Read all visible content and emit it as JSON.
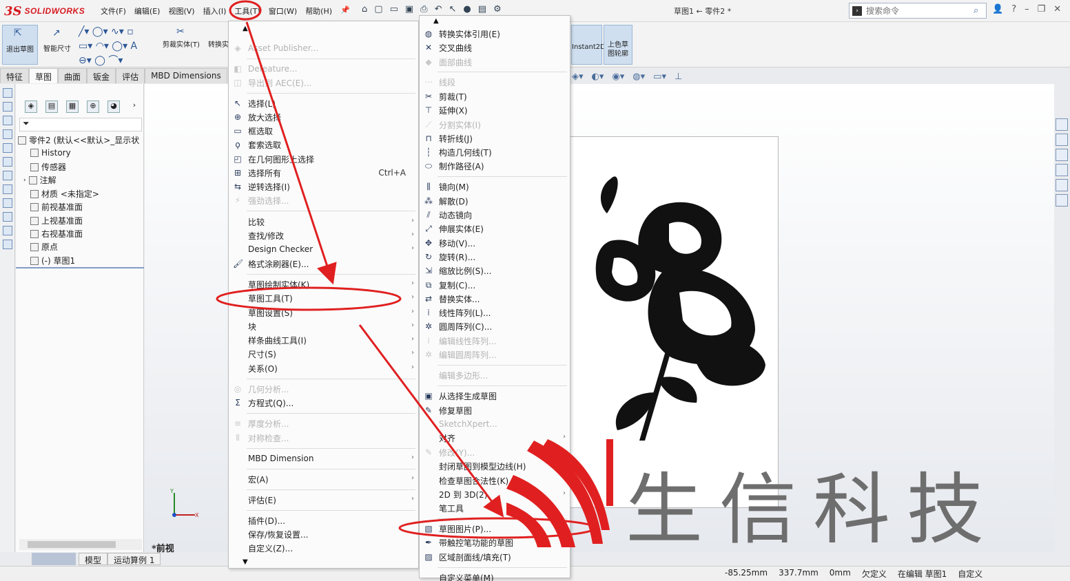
{
  "app": {
    "logo_ds": "3S",
    "logo_name": "SOLIDWORKS",
    "doc_title": "草图1 ← 零件2 *",
    "search_placeholder": "搜索命令"
  },
  "menubar": [
    "文件(F)",
    "编辑(E)",
    "视图(V)",
    "插入(I)",
    "工具(T)",
    "窗口(W)",
    "帮助(H)"
  ],
  "commands": {
    "exit_sketch": "退出草图",
    "smart_dim": "智能尺寸",
    "trim": "剪裁实体(T)",
    "convert": "转换实",
    "instant2d": "Instant2D",
    "shaded_line1": "上色草",
    "shaded_line2": "图轮廓"
  },
  "tabs": [
    "特征",
    "草图",
    "曲面",
    "钣金",
    "评估",
    "MBD Dimensions"
  ],
  "tree": {
    "root": "零件2 (默认<<默认>_显示状",
    "items": [
      "History",
      "传感器",
      "注解",
      "材质 <未指定>",
      "前视基准面",
      "上视基准面",
      "右视基准面",
      "原点",
      "(-) 草图1"
    ]
  },
  "bottom_tabs": [
    "模型",
    "运动算例 1"
  ],
  "view_label": "*前视",
  "tools_menu": {
    "items": [
      {
        "label": "Asset Publisher...",
        "disabled": true,
        "icon": "asset-icon"
      },
      {
        "label": "Defeature...",
        "disabled": true,
        "icon": "defeature-icon"
      },
      {
        "label": "导出到 AEC(E)...",
        "disabled": true,
        "icon": "aec-icon"
      },
      {
        "label": "选择(L)",
        "icon": "select-icon"
      },
      {
        "label": "放大选择",
        "icon": "magnify-icon"
      },
      {
        "label": "框选取",
        "icon": "box-select-icon"
      },
      {
        "label": "套索选取",
        "icon": "lasso-icon"
      },
      {
        "label": "在几何图形上选择",
        "icon": "geometry-select-icon"
      },
      {
        "label": "选择所有",
        "shortcut": "Ctrl+A",
        "icon": "select-all-icon"
      },
      {
        "label": "逆转选择(I)",
        "icon": "invert-select-icon"
      },
      {
        "label": "强劲选择...",
        "disabled": true,
        "icon": "power-select-icon"
      },
      {
        "label": "比较",
        "submenu": true
      },
      {
        "label": "查找/修改",
        "submenu": true
      },
      {
        "label": "Design Checker",
        "submenu": true
      },
      {
        "label": "格式涂刷器(E)...",
        "icon": "format-painter-icon"
      },
      {
        "label": "草图绘制实体(K)",
        "submenu": true
      },
      {
        "label": "草图工具(T)",
        "submenu": true
      },
      {
        "label": "草图设置(S)",
        "submenu": true
      },
      {
        "label": "块",
        "submenu": true
      },
      {
        "label": "样条曲线工具(I)",
        "submenu": true
      },
      {
        "label": "尺寸(S)",
        "submenu": true
      },
      {
        "label": "关系(O)",
        "submenu": true
      },
      {
        "label": "几何分析...",
        "disabled": true,
        "icon": "geometry-analysis-icon"
      },
      {
        "label": "方程式(Q)...",
        "icon": "sigma-icon"
      },
      {
        "label": "厚度分析...",
        "disabled": true,
        "icon": "thickness-icon"
      },
      {
        "label": "对称检查...",
        "disabled": true,
        "icon": "symmetry-icon"
      },
      {
        "label": "MBD Dimension",
        "submenu": true
      },
      {
        "label": "宏(A)",
        "submenu": true
      },
      {
        "label": "评估(E)",
        "submenu": true
      },
      {
        "label": "插件(D)..."
      },
      {
        "label": "保存/恢复设置..."
      },
      {
        "label": "自定义(Z)..."
      }
    ]
  },
  "sketch_menu": {
    "items": [
      {
        "label": "转换实体引用(E)",
        "icon": "convert-icon"
      },
      {
        "label": "交叉曲线",
        "icon": "intersect-icon"
      },
      {
        "label": "面部曲线",
        "disabled": true,
        "icon": "face-curve-icon"
      },
      {
        "label": "线段",
        "disabled": true,
        "icon": "segment-icon"
      },
      {
        "label": "剪裁(T)",
        "icon": "trim-icon"
      },
      {
        "label": "延伸(X)",
        "icon": "extend-icon"
      },
      {
        "label": "分割实体(I)",
        "disabled": true,
        "icon": "split-icon"
      },
      {
        "label": "转折线(J)",
        "icon": "jog-icon"
      },
      {
        "label": "构造几何线(T)",
        "icon": "construction-icon"
      },
      {
        "label": "制作路径(A)",
        "icon": "path-icon"
      },
      {
        "label": "镜向(M)",
        "icon": "mirror-icon"
      },
      {
        "label": "解散(D)",
        "icon": "dissolve-icon"
      },
      {
        "label": "动态镜向",
        "icon": "dynamic-mirror-icon"
      },
      {
        "label": "伸展实体(E)",
        "icon": "stretch-icon"
      },
      {
        "label": "移动(V)...",
        "icon": "move-icon"
      },
      {
        "label": "旋转(R)...",
        "icon": "rotate-icon"
      },
      {
        "label": "缩放比例(S)...",
        "icon": "scale-icon"
      },
      {
        "label": "复制(C)...",
        "icon": "copy-icon"
      },
      {
        "label": "替换实体...",
        "icon": "replace-icon"
      },
      {
        "label": "线性阵列(L)...",
        "icon": "linear-pattern-icon"
      },
      {
        "label": "圆周阵列(C)...",
        "icon": "circular-pattern-icon"
      },
      {
        "label": "编辑线性阵列...",
        "disabled": true,
        "icon": "edit-linear-icon"
      },
      {
        "label": "编辑圆周阵列...",
        "disabled": true,
        "icon": "edit-circular-icon"
      },
      {
        "label": "编辑多边形...",
        "disabled": true
      },
      {
        "label": "从选择生成草图",
        "icon": "sketch-from-selection-icon"
      },
      {
        "label": "修复草图",
        "icon": "repair-icon"
      },
      {
        "label": "SketchXpert...",
        "disabled": true
      },
      {
        "label": "对齐",
        "submenu": true
      },
      {
        "label": "修改(Y)...",
        "disabled": true,
        "icon": "modify-icon"
      },
      {
        "label": "封闭草图到模型边线(H)"
      },
      {
        "label": "检查草图合法性(K)..."
      },
      {
        "label": "2D 到 3D(2)",
        "submenu": true
      },
      {
        "label": "笔工具"
      },
      {
        "label": "草图图片(P)...",
        "icon": "picture-icon"
      },
      {
        "label": "带触控笔功能的草图",
        "icon": "stylus-icon"
      },
      {
        "label": "区域剖面线/填充(T)",
        "icon": "hatch-icon"
      },
      {
        "label": "自定义菜单(M)"
      }
    ]
  },
  "status": {
    "x": "-85.25mm",
    "y": "337.7mm",
    "z": "0mm",
    "state": "欠定义",
    "editing": "在编辑 草图1",
    "units": "自定义"
  },
  "watermark": "生信科技",
  "colors": {
    "annotation": "#e02020",
    "brand": "#d71920",
    "menu_bg": "#fbfbfb",
    "watermark_gray": "#6e6e6e"
  }
}
